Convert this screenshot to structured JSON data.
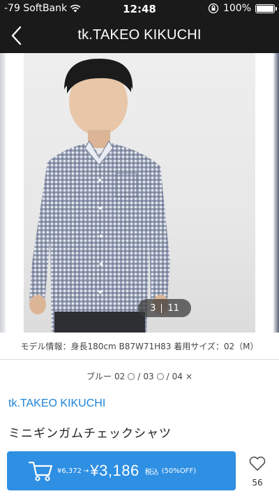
{
  "status_bar": {
    "carrier": "-79 SoftBank",
    "time": "12:48",
    "battery": "100%",
    "battery_level": 1.0
  },
  "nav": {
    "title": "tk.TAKEO KIKUCHI"
  },
  "gallery": {
    "current_page": "3",
    "total_pages": "11"
  },
  "model_info": "モデル情報：身長180cm B87W71H83 着用サイズ：02（M）",
  "variants": {
    "color": "ブルー",
    "sizes": [
      {
        "label": "02",
        "status": "○"
      },
      {
        "label": "03",
        "status": "○"
      },
      {
        "label": "04",
        "status": "×"
      }
    ],
    "separator": "/"
  },
  "product": {
    "brand": "tk.TAKEO KIKUCHI",
    "name": "ミニギンガムチェックシャツ"
  },
  "purchase": {
    "original_price": "¥6,372",
    "arrow": "→",
    "sale_price": "¥3,186",
    "tax_label": "税込",
    "discount": "(50%OFF)"
  },
  "favorite": {
    "count": "56"
  },
  "colors": {
    "bar_bg": "#1a1a1a",
    "accent_blue": "#2e8fe3",
    "link_blue": "#1e83d8"
  },
  "icons": {
    "back": "chevron-left-icon",
    "cart": "cart-icon",
    "favorite": "heart-icon",
    "wifi": "wifi-icon",
    "lock": "orientation-lock-icon"
  }
}
